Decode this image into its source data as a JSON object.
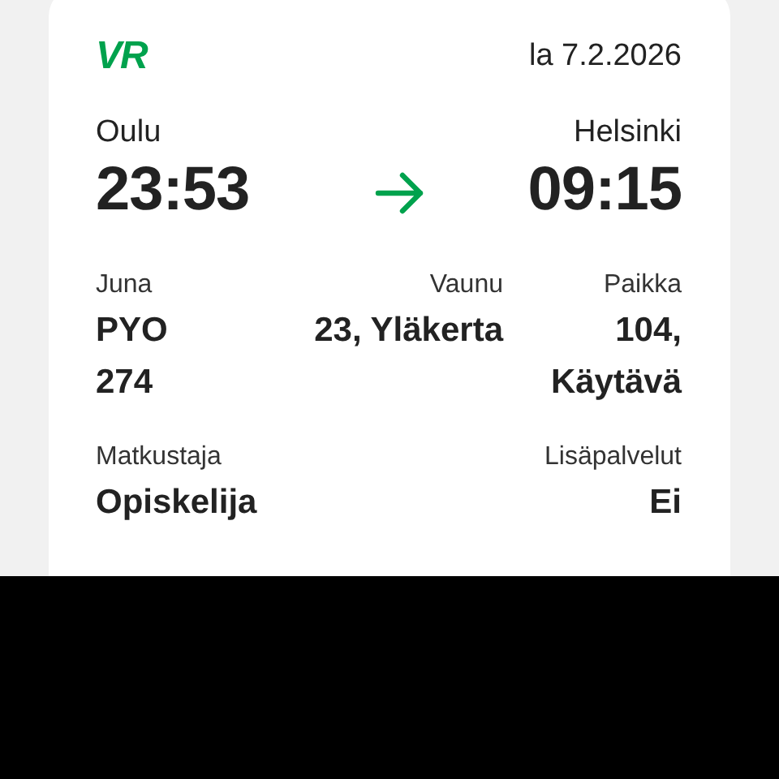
{
  "logo": "VR",
  "date": "la 7.2.2026",
  "route": {
    "from": "Oulu",
    "departure": "23:53",
    "to": "Helsinki",
    "arrival": "09:15"
  },
  "details": [
    {
      "label": "Juna",
      "value": "PYO 274"
    },
    {
      "label": "Vaunu",
      "value": "23, Yläkerta"
    },
    {
      "label": "Paikka",
      "value": "104, Käytävä"
    }
  ],
  "passenger": [
    {
      "label": "Matkustaja",
      "value": "Opiskelija"
    },
    {
      "label": "Lisäpalvelut",
      "value": "Ei"
    }
  ]
}
